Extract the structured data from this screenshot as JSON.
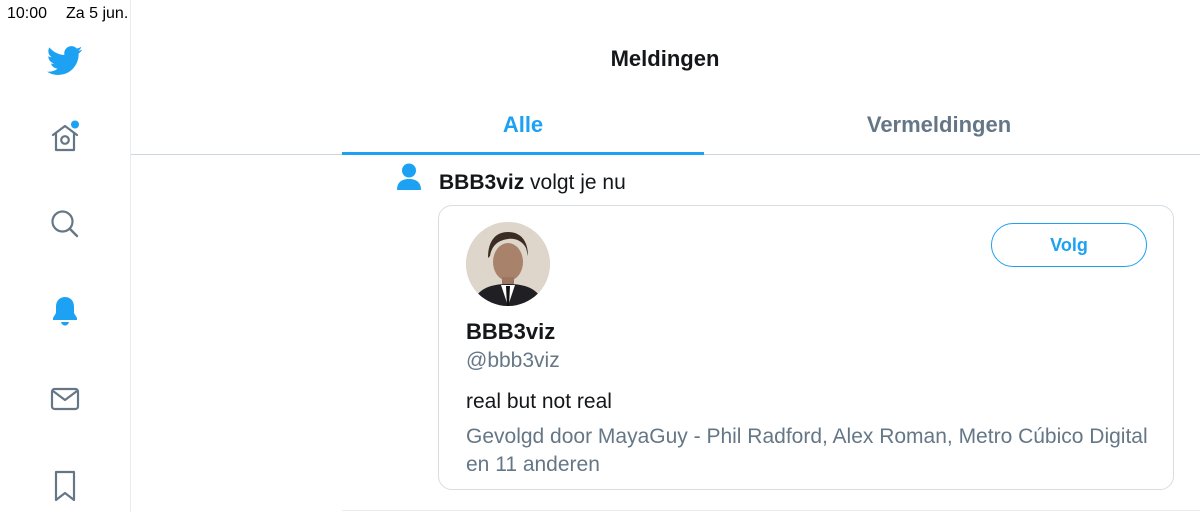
{
  "status_bar": {
    "time": "10:00",
    "date": "Za 5 jun."
  },
  "sidebar": {
    "items": [
      {
        "icon": "twitter-bird-icon"
      },
      {
        "icon": "home-icon"
      },
      {
        "icon": "search-icon"
      },
      {
        "icon": "bell-icon"
      },
      {
        "icon": "mail-icon"
      },
      {
        "icon": "bookmark-icon"
      }
    ]
  },
  "header": {
    "title": "Meldingen"
  },
  "tabs": [
    {
      "label": "Alle",
      "active": true
    },
    {
      "label": "Vermeldingen",
      "active": false
    }
  ],
  "notification": {
    "icon": "person-icon",
    "actor_name": "BBB3viz",
    "action_text": " volgt je nu",
    "card": {
      "display_name": "BBB3viz",
      "handle": "@bbb3viz",
      "bio": "real but not real",
      "followed_by": "Gevolgd door MayaGuy - Phil Radford, Alex Roman, Metro Cúbico Digital en 11 anderen",
      "follow_label": "Volg"
    }
  },
  "colors": {
    "accent": "#1da1f2",
    "muted": "#657786",
    "text": "#14171a",
    "border": "#e6ecf0"
  }
}
